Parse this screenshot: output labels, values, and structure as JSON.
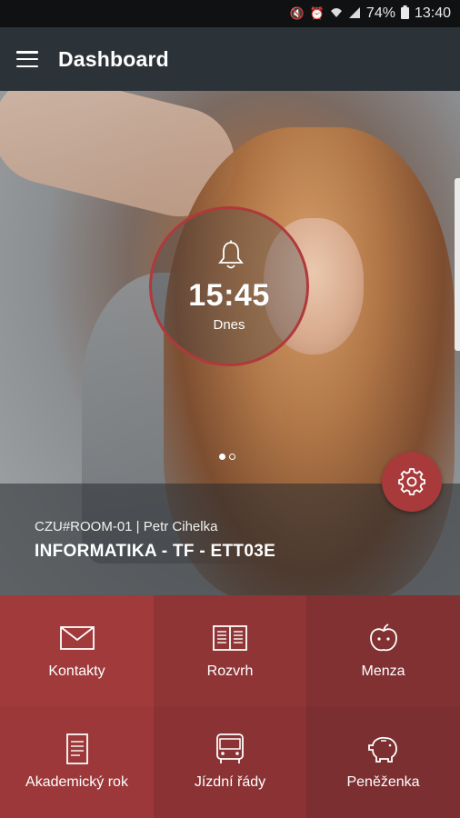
{
  "status_bar": {
    "battery": "74%",
    "time": "13:40"
  },
  "app_bar": {
    "title": "Dashboard"
  },
  "hero": {
    "clock_time": "15:45",
    "clock_day": "Dnes",
    "pager_total": 2,
    "pager_active": 1,
    "room_info": "CZU#ROOM-01 | Petr Cihelka",
    "subject": "INFORMATIKA - TF - ETT03E"
  },
  "tiles": [
    {
      "label": "Kontakty",
      "icon": "envelope-icon"
    },
    {
      "label": "Rozvrh",
      "icon": "book-icon"
    },
    {
      "label": "Menza",
      "icon": "apple-icon"
    },
    {
      "label": "Akademický rok",
      "icon": "document-icon"
    },
    {
      "label": "Jízdní řády",
      "icon": "bus-icon"
    },
    {
      "label": "Peněženka",
      "icon": "piggy-bank-icon"
    }
  ],
  "colors": {
    "accent": "#a83a3b",
    "appbar": "#2c3338"
  }
}
